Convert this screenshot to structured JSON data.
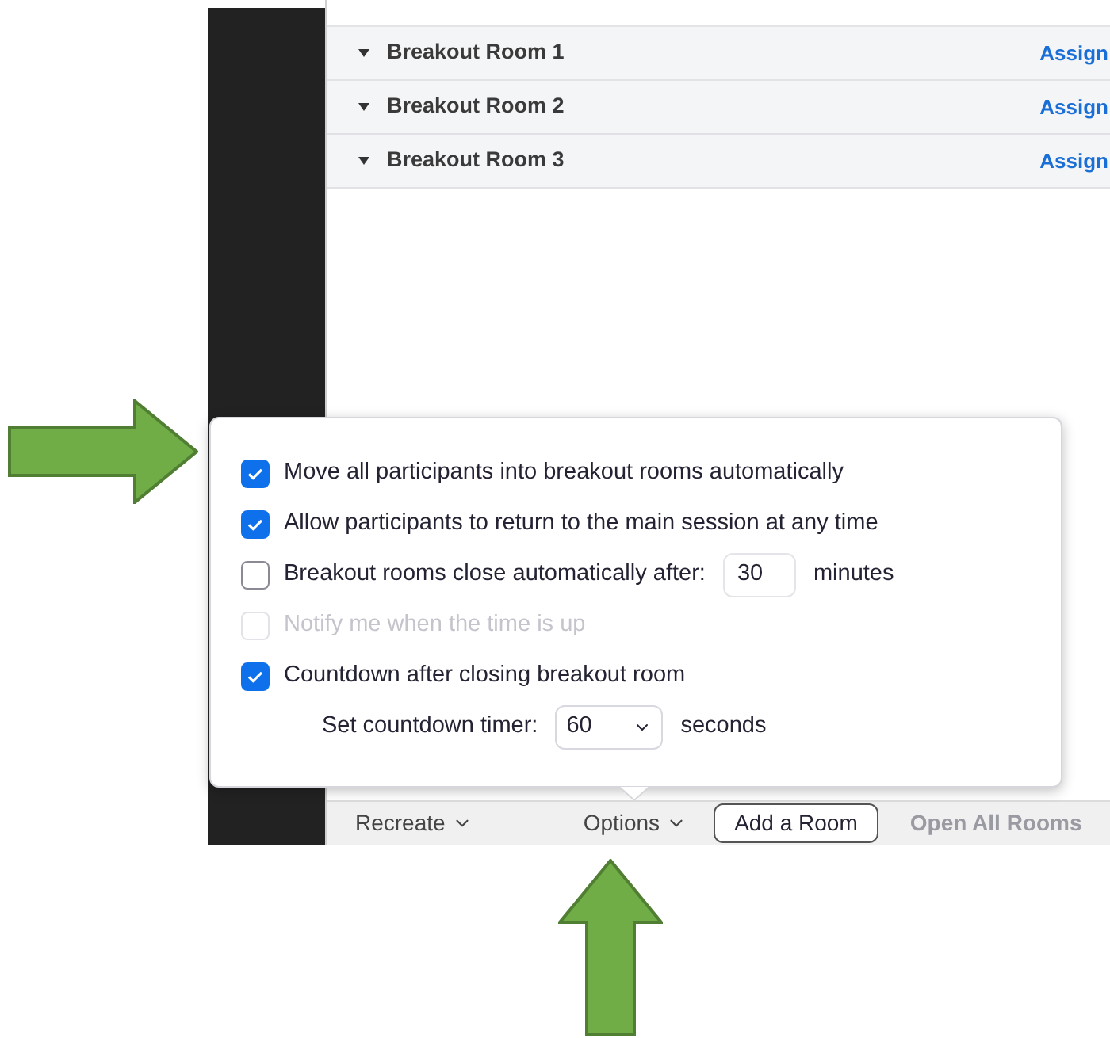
{
  "rooms": [
    {
      "name": "Breakout Room 1",
      "action": "Assign"
    },
    {
      "name": "Breakout Room 2",
      "action": "Assign"
    },
    {
      "name": "Breakout Room 3",
      "action": "Assign"
    }
  ],
  "options_popover": {
    "options": [
      {
        "label": "Move all participants into breakout rooms automatically",
        "checked": true,
        "disabled": false
      },
      {
        "label": "Allow participants to return to the main session at any time",
        "checked": true,
        "disabled": false
      },
      {
        "label": "Breakout rooms close automatically after:",
        "checked": false,
        "disabled": false,
        "value": "30",
        "unit": "minutes"
      },
      {
        "label": "Notify me when the time is up",
        "checked": false,
        "disabled": true
      },
      {
        "label": "Countdown after closing breakout room",
        "checked": true,
        "disabled": false
      }
    ],
    "countdown": {
      "label": "Set countdown timer:",
      "value": "60",
      "unit": "seconds"
    }
  },
  "bottom_bar": {
    "recreate": "Recreate",
    "options": "Options",
    "add_room": "Add a Room",
    "open_all": "Open All Rooms"
  }
}
